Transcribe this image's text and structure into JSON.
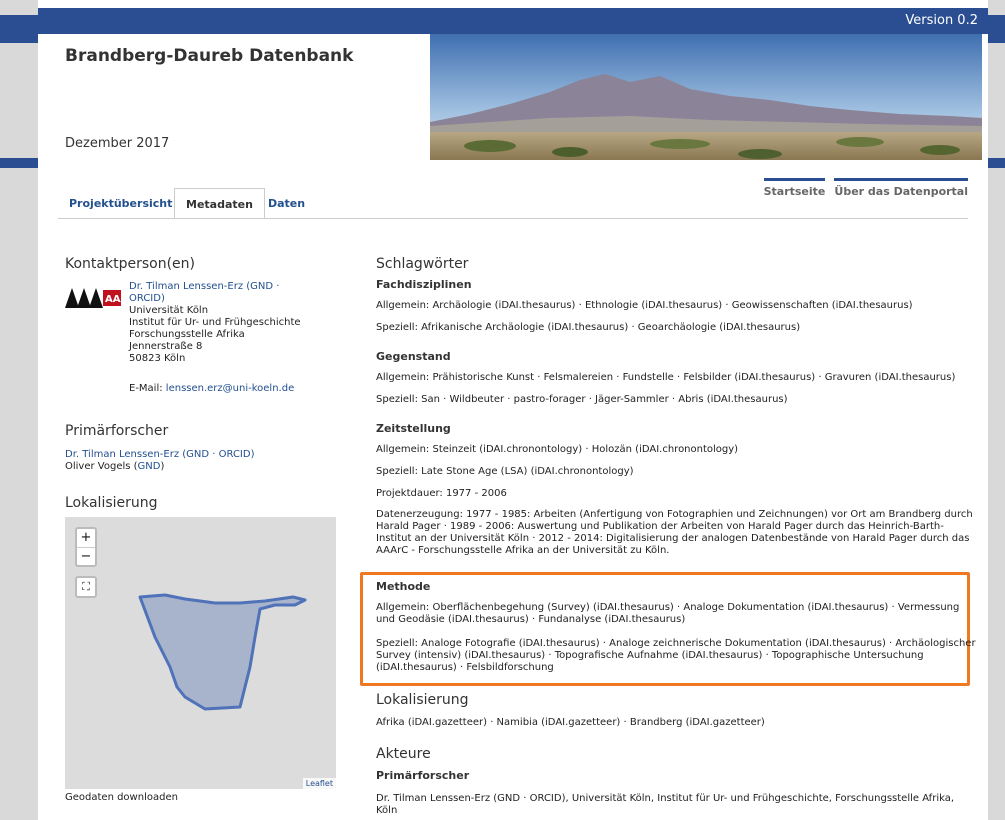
{
  "header": {
    "version": "Version 0.2",
    "title": "Brandberg-Daureb Datenbank",
    "date": "Dezember 2017"
  },
  "tabs": [
    "Projektübersicht",
    "Metadaten",
    "Daten"
  ],
  "top_links": [
    "Startseite",
    "Über das Datenportal"
  ],
  "kontakt": {
    "heading": "Kontaktperson(en)",
    "name": "Dr. Tilman Lenssen-Erz (GND ·",
    "orcid": "ORCID)",
    "org1": "Universität Köln",
    "org2": "Institut für Ur- und Frühgeschichte",
    "org3": "Forschungsstelle Afrika",
    "street": "Jennerstraße 8",
    "city": "50823 Köln",
    "email_label": "E-Mail: ",
    "email": "lenssen.erz@uni-koeln.de",
    "logo_text": "AAArC"
  },
  "primaer": {
    "heading": "Primärforscher",
    "line1": "Dr. Tilman Lenssen-Erz (GND · ORCID)",
    "line2_name": "Oliver Vogels (",
    "line2_link": "GND",
    "line2_end": ")"
  },
  "lokal_left": {
    "heading": "Lokalisierung",
    "zoom_in": "+",
    "zoom_out": "−",
    "fullscreen": "⛶",
    "leaflet": "Leaflet",
    "download": "Geodaten downloaden"
  },
  "schlag": {
    "heading": "Schlagwörter",
    "fach": "Fachdisziplinen",
    "fach_allg_label": "Allgemein: ",
    "fach_allg": "Archäologie (iDAI.thesaurus) · Ethnologie (iDAI.thesaurus) · Geowissenschaften (iDAI.thesaurus)",
    "fach_spez_label": "Speziell: ",
    "fach_spez": "Afrikanische Archäologie (iDAI.thesaurus) · Geoarchäologie (iDAI.thesaurus)",
    "gegen": "Gegenstand",
    "gegen_allg_label": "Allgemein: ",
    "gegen_allg": "Prähistorische Kunst · Felsmalereien · Fundstelle · Felsbilder (iDAI.thesaurus) · Gravuren (iDAI.thesaurus)",
    "gegen_spez_label": "Speziell: ",
    "gegen_spez": "San · Wildbeuter · pastro-forager · Jäger-Sammler · Abris (iDAI.thesaurus)",
    "zeit": "Zeitstellung",
    "zeit_allg_label": "Allgemein: ",
    "zeit_allg": "Steinzeit (iDAI.chronontology) · Holozän (iDAI.chronontology)",
    "zeit_spez_label": "Speziell: ",
    "zeit_spez": "Late Stone Age (LSA) (iDAI.chronontology)",
    "dauer": "Projektdauer: 1977 - 2006",
    "erz1": "Datenerzeugung: 1977 - 1985: Arbeiten (Anfertigung von Fotographien und Zeichnungen) vor Ort am Brandberg durch",
    "erz2": "Harald Pager · 1989 - 2006: Auswertung und Publikation der Arbeiten von Harald Pager durch das Heinrich-Barth-",
    "erz3": "Institut an der Universität Köln · 2012 - 2014: Digitalisierung der analogen Datenbestände von Harald Pager durch das",
    "erz4": "AAArC - Forschungsstelle Afrika an der Universität zu Köln.",
    "methode": "Methode",
    "meth_allg_label": "Allgemein: ",
    "meth_allg1": "Oberflächenbegehung (Survey) (iDAI.thesaurus) · Analoge Dokumentation (iDAI.thesaurus) · Vermessung",
    "meth_allg2": "und Geodäsie (iDAI.thesaurus) · Fundanalyse (iDAI.thesaurus)",
    "meth_spez_label": "Speziell: ",
    "meth_spez1": "Analoge Fotografie (iDAI.thesaurus) · Analoge zeichnerische Dokumentation (iDAI.thesaurus) · Archäologischer",
    "meth_spez2": "Survey (intensiv) (iDAI.thesaurus) · Topografische Aufnahme (iDAI.thesaurus) · Topographische Untersuchung",
    "meth_spez3": "(iDAI.thesaurus) · Felsbildforschung"
  },
  "lokal_right": {
    "heading": "Lokalisierung",
    "text": "Afrika (iDAI.gazetteer) · Namibia (iDAI.gazetteer) · Brandberg (iDAI.gazetteer)"
  },
  "akteure": {
    "heading": "Akteure",
    "primaer": "Primärforscher",
    "line1": "Dr. Tilman Lenssen-Erz (GND · ORCID), Universität Köln, Institut für Ur- und Frühgeschichte, Forschungsstelle Afrika,",
    "line2": "Köln"
  },
  "colors": {
    "brand": "#2a4e91",
    "link": "#23508e",
    "highlight": "#f07820"
  }
}
